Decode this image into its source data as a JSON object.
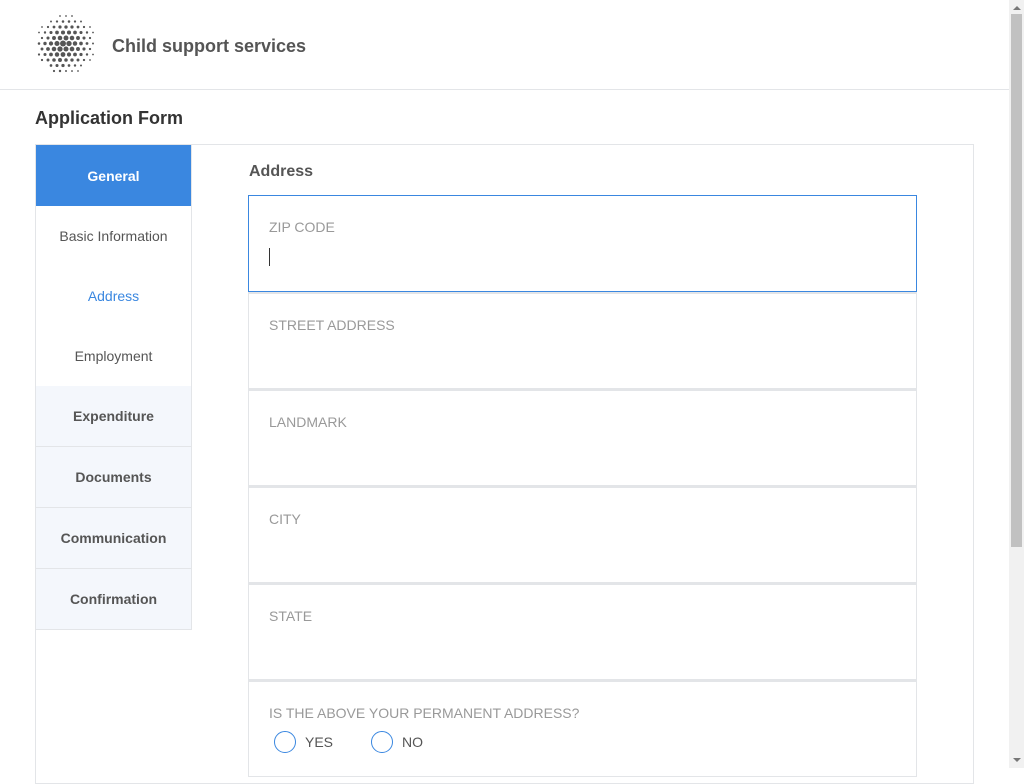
{
  "header": {
    "app_title": "Child support services"
  },
  "page_title": "Application Form",
  "sidebar": {
    "items": [
      {
        "label": "General",
        "type": "section",
        "active": true
      },
      {
        "label": "Basic Information",
        "type": "sub"
      },
      {
        "label": "Address",
        "type": "sub",
        "current": true
      },
      {
        "label": "Employment",
        "type": "sub"
      },
      {
        "label": "Expenditure",
        "type": "section"
      },
      {
        "label": "Documents",
        "type": "section"
      },
      {
        "label": "Communication",
        "type": "section"
      },
      {
        "label": "Confirmation",
        "type": "section"
      }
    ]
  },
  "form": {
    "title": "Address",
    "fields": [
      "ZIP CODE",
      "STREET ADDRESS",
      "LANDMARK",
      "CITY",
      "STATE"
    ],
    "question": "IS THE ABOVE YOUR PERMANENT ADDRESS?",
    "options": [
      "YES",
      "NO"
    ]
  },
  "colors": {
    "accent": "#3a87e0"
  }
}
